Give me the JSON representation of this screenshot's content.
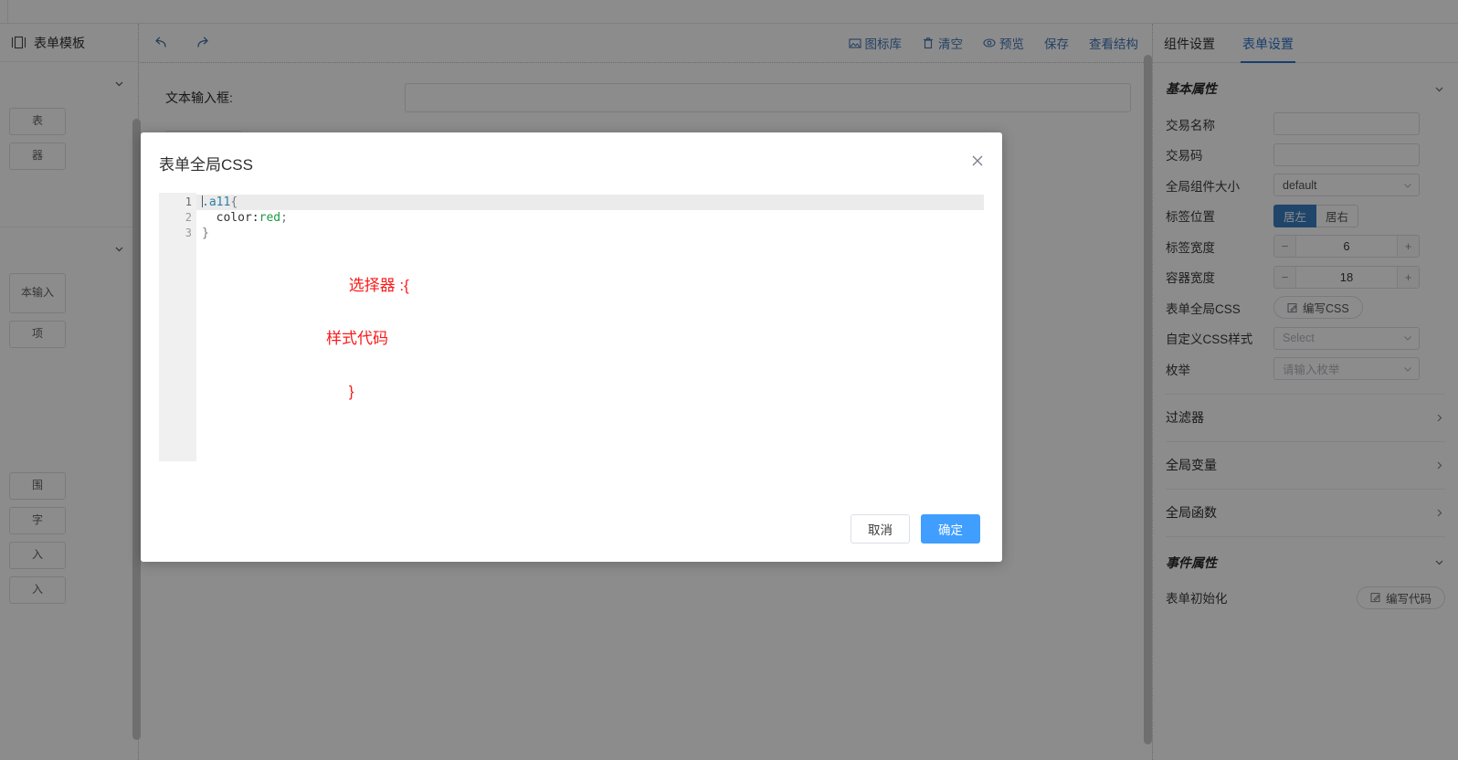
{
  "sidebar": {
    "header_label": "表单模板",
    "header_icon": "layout-panel-icon",
    "groups": [
      {
        "title": "",
        "items": [
          "表",
          "器"
        ]
      },
      {
        "title": "",
        "items": [
          "本输入",
          "项",
          "围",
          "字",
          "入",
          "入"
        ]
      }
    ]
  },
  "toolbar": {
    "undo_icon": "undo-arrow-icon",
    "redo_icon": "redo-arrow-icon",
    "actions": [
      {
        "label": "图标库",
        "icon": "image-library-icon"
      },
      {
        "label": "清空",
        "icon": "trash-icon"
      },
      {
        "label": "预览",
        "icon": "eye-icon"
      },
      {
        "label": "保存",
        "icon": ""
      },
      {
        "label": "查看结构",
        "icon": ""
      }
    ]
  },
  "canvas": {
    "field_label": "文本输入框:",
    "field_value": "",
    "field_placeholder": ""
  },
  "right_panel": {
    "tabs": [
      {
        "label": "组件设置",
        "active": false
      },
      {
        "label": "表单设置",
        "active": true
      }
    ],
    "basic_section": {
      "title": "基本属性",
      "chevron_icon": "chevron-down-icon",
      "rows": {
        "trade_name_label": "交易名称",
        "trade_name_value": "",
        "trade_code_label": "交易码",
        "trade_code_value": "",
        "global_size_label": "全局组件大小",
        "global_size_value": "default",
        "label_pos_label": "标签位置",
        "label_pos_left": "居左",
        "label_pos_right": "居右",
        "label_width_label": "标签宽度",
        "label_width_value": "6",
        "container_width_label": "容器宽度",
        "container_width_value": "18",
        "global_css_label": "表单全局CSS",
        "global_css_button": "编写CSS",
        "custom_css_label": "自定义CSS样式",
        "custom_css_placeholder": "Select",
        "enum_label": "枚举",
        "enum_placeholder": "请输入枚举"
      }
    },
    "collapse_rows": [
      {
        "label": "过滤器",
        "icon": "chevron-right-icon"
      },
      {
        "label": "全局变量",
        "icon": "chevron-right-icon"
      },
      {
        "label": "全局函数",
        "icon": "chevron-right-icon"
      }
    ],
    "event_section": {
      "title": "事件属性",
      "chevron_icon": "chevron-down-icon",
      "init_label": "表单初始化",
      "init_button": "编写代码"
    }
  },
  "modal": {
    "title": "表单全局CSS",
    "close_icon": "close-icon",
    "editor": {
      "line_numbers": [
        "1",
        "2",
        "3"
      ],
      "lines": [
        {
          "num": "1",
          "selector": ".a11",
          "brace": "{"
        },
        {
          "num": "2",
          "prop": "  color:",
          "value": "red",
          "semi": ";"
        },
        {
          "num": "3",
          "brace": "}"
        }
      ]
    },
    "annotation": {
      "line1": "选择器 :{",
      "line2": "样式代码",
      "line3": "}",
      "color": "#fb1a1a"
    },
    "cancel_label": "取消",
    "confirm_label": "确定"
  },
  "colors": {
    "accent": "#409eff",
    "tab_active": "#2a72c8",
    "toggle_active": "#3a7fc4",
    "link": "#4076b5",
    "annotation_red": "#fb1a1a",
    "code_selector": "#2a7fa8",
    "code_value": "#1a9a42"
  }
}
